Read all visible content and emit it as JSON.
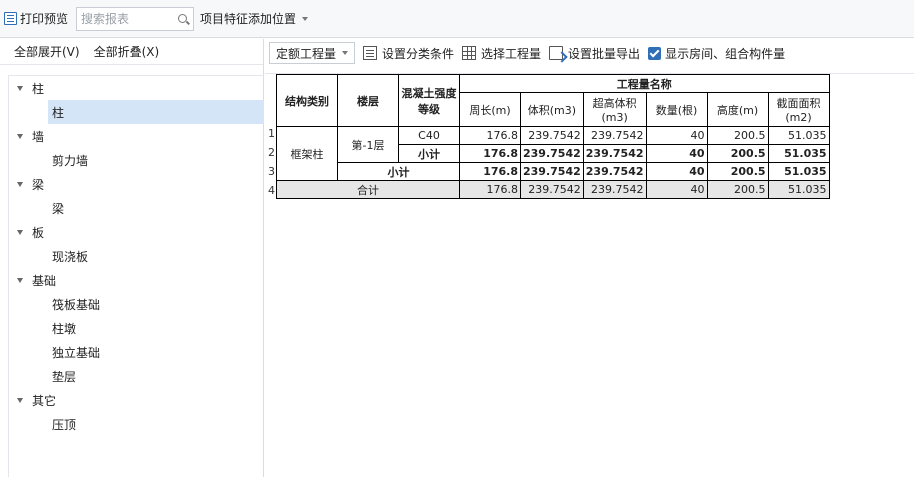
{
  "toolbar": {
    "print_preview": "打印预览",
    "search_placeholder": "搜索报表",
    "feature_position": "项目特征添加位置"
  },
  "left": {
    "expand_all": "全部展开(V)",
    "collapse_all": "全部折叠(X)",
    "groups": [
      {
        "label": "柱",
        "items": [
          "柱"
        ]
      },
      {
        "label": "墙",
        "items": [
          "剪力墙"
        ]
      },
      {
        "label": "梁",
        "items": [
          "梁"
        ]
      },
      {
        "label": "板",
        "items": [
          "现浇板"
        ]
      },
      {
        "label": "基础",
        "items": [
          "筏板基础",
          "柱墩",
          "独立基础",
          "垫层"
        ]
      },
      {
        "label": "其它",
        "items": [
          "压顶"
        ]
      }
    ]
  },
  "right": {
    "quota_combo": "定额工程量",
    "set_classify": "设置分类条件",
    "select_quantity": "选择工程量",
    "batch_export": "设置批量导出",
    "show_rooms": "显示房间、组合构件量"
  },
  "report": {
    "headers": {
      "struct_type": "结构类别",
      "floor": "楼层",
      "concrete_grade": "混凝土强度等级",
      "quantity_name": "工程量名称",
      "cols": [
        "周长(m)",
        "体积(m3)",
        "超高体积(m3)",
        "数量(根)",
        "高度(m)",
        "截面面积(m2)"
      ]
    },
    "row_numbers": [
      "1",
      "2",
      "3",
      "4"
    ],
    "struct_type_value": "框架柱",
    "floor_value": "第-1层",
    "grade_value": "C40",
    "subtotal_label": "小计",
    "total_label": "合计",
    "rows": [
      [
        "176.8",
        "239.7542",
        "239.7542",
        "40",
        "200.5",
        "51.035"
      ],
      [
        "176.8",
        "239.7542",
        "239.7542",
        "40",
        "200.5",
        "51.035"
      ],
      [
        "176.8",
        "239.7542",
        "239.7542",
        "40",
        "200.5",
        "51.035"
      ],
      [
        "176.8",
        "239.7542",
        "239.7542",
        "40",
        "200.5",
        "51.035"
      ]
    ]
  }
}
